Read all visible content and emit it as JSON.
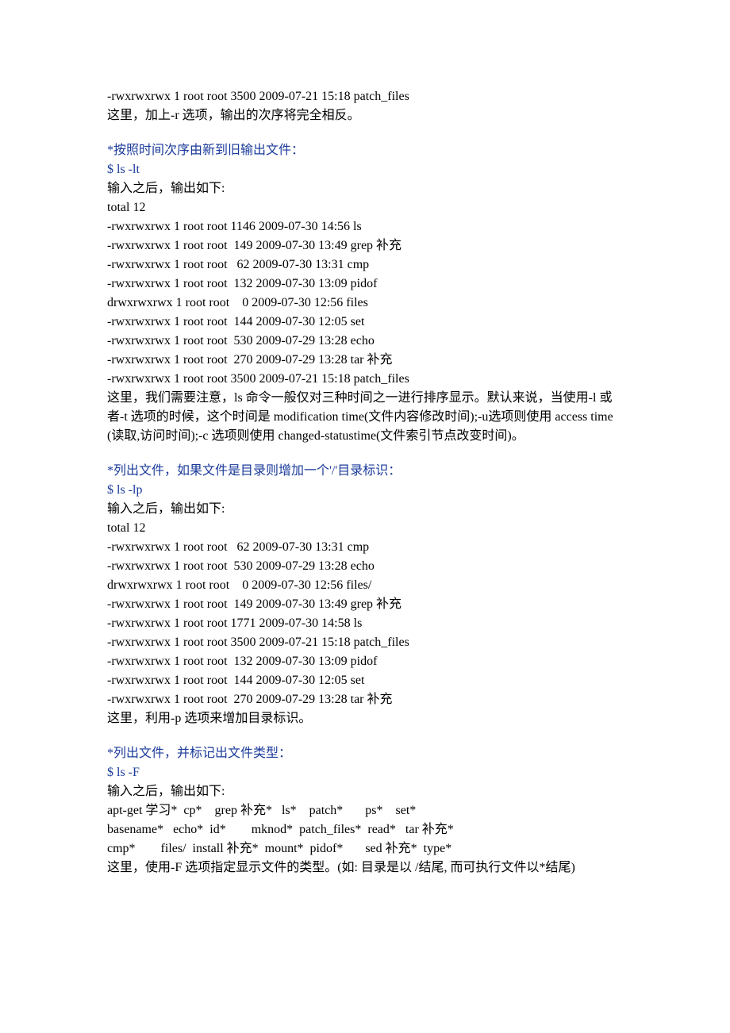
{
  "s1": {
    "l1": "-rwxrwxrwx 1 root root 3500 2009-07-21 15:18 patch_files",
    "l2": "这里，加上-r 选项，输出的次序将完全相反。"
  },
  "s2": {
    "title": "*按照时间次序由新到旧输出文件：",
    "cmd": "$ ls -lt",
    "l1": "输入之后，输出如下:",
    "l2": "total 12",
    "l3": "-rwxrwxrwx 1 root root 1146 2009-07-30 14:56 ls",
    "l4": "-rwxrwxrwx 1 root root  149 2009-07-30 13:49 grep 补充",
    "l5": "-rwxrwxrwx 1 root root   62 2009-07-30 13:31 cmp",
    "l6": "-rwxrwxrwx 1 root root  132 2009-07-30 13:09 pidof",
    "l7": "drwxrwxrwx 1 root root    0 2009-07-30 12:56 files",
    "l8": "-rwxrwxrwx 1 root root  144 2009-07-30 12:05 set",
    "l9": "-rwxrwxrwx 1 root root  530 2009-07-29 13:28 echo",
    "l10": "-rwxrwxrwx 1 root root  270 2009-07-29 13:28 tar 补充",
    "l11": "-rwxrwxrwx 1 root root 3500 2009-07-21 15:18 patch_files",
    "l12": "这里，我们需要注意，ls 命令一般仅对三种时间之一进行排序显示。默认来说，当使用-l 或者-t 选项的时候，这个时间是 modification time(文件内容修改时间);-u选项则使用 access time(读取,访问时间);-c 选项则使用 changed-statustime(文件索引节点改变时间)。"
  },
  "s3": {
    "title": "*列出文件，如果文件是目录则增加一个'/'目录标识：",
    "cmd": "$ ls -lp",
    "l1": "输入之后，输出如下:",
    "l2": "total 12",
    "l3": "-rwxrwxrwx 1 root root   62 2009-07-30 13:31 cmp",
    "l4": "-rwxrwxrwx 1 root root  530 2009-07-29 13:28 echo",
    "l5": "drwxrwxrwx 1 root root    0 2009-07-30 12:56 files/",
    "l6": "-rwxrwxrwx 1 root root  149 2009-07-30 13:49 grep 补充",
    "l7": "-rwxrwxrwx 1 root root 1771 2009-07-30 14:58 ls",
    "l8": "-rwxrwxrwx 1 root root 3500 2009-07-21 15:18 patch_files",
    "l9": "-rwxrwxrwx 1 root root  132 2009-07-30 13:09 pidof",
    "l10": "-rwxrwxrwx 1 root root  144 2009-07-30 12:05 set",
    "l11": "-rwxrwxrwx 1 root root  270 2009-07-29 13:28 tar 补充",
    "l12": "这里，利用-p 选项来增加目录标识。"
  },
  "s4": {
    "title": "*列出文件，并标记出文件类型：",
    "cmd": "$ ls -F",
    "l1": "输入之后，输出如下:",
    "l2": "apt-get 学习*  cp*    grep 补充*   ls*    patch*       ps*    set*",
    "l3": "basename*   echo*  id*        mknod*  patch_files*  read*   tar 补充*",
    "l4": "cmp*        files/  install 补充*  mount*  pidof*       sed 补充*  type*",
    "l5": "这里，使用-F 选项指定显示文件的类型。(如: 目录是以 /结尾, 而可执行文件以*结尾)"
  }
}
